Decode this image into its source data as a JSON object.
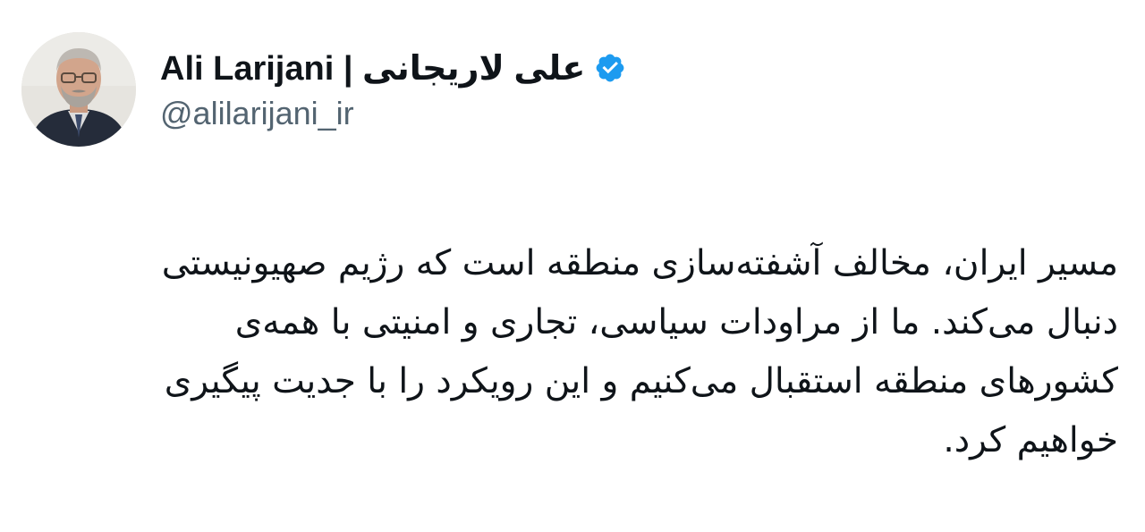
{
  "author": {
    "display_name": "علی لاریجانی | Ali Larijani",
    "handle": "@alilarijani_ir",
    "verified": true,
    "avatar_icon": "profile-photo"
  },
  "tweet": {
    "lines": [
      "مسیر ایران، مخالف آشفته‌سازی منطقه است که رژیم صهیونیستی",
      "دنبال می‌کند. ما از مراودات سیاسی، تجاری و امنیتی با همه‌ی",
      "کشورهای منطقه استقبال می‌کنیم و این رویکرد را با جدیت پیگیری",
      "خواهیم کرد."
    ]
  },
  "colors": {
    "verified_badge": "#1d9bf0",
    "handle_text": "#536471",
    "body_text": "#0f1419"
  }
}
